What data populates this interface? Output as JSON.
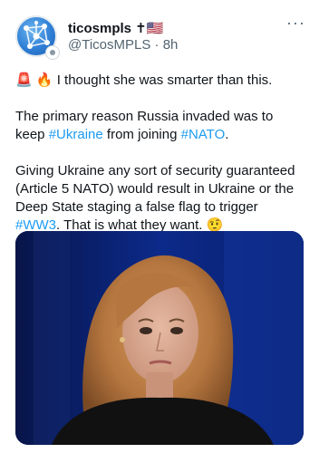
{
  "post": {
    "author": {
      "display_name": "ticosmpls ✝🇺🇸",
      "handle": "@TicosMPLS",
      "separator": "·",
      "timestamp": "8h"
    },
    "more_menu_label": "···",
    "text": {
      "line1_emoji": "🚨 🔥",
      "line1_text": " I thought she was smarter than this.",
      "p2_before": "The primary reason Russia invaded was to keep ",
      "p2_hashtag1": "#Ukraine",
      "p2_middle": " from joining ",
      "p2_hashtag2": "#NATO",
      "p2_after": ".",
      "p3_before": "Giving Ukraine any sort of security guaranteed (Article 5 NATO) would result in Ukraine or the Deep State staging a false flag to trigger ",
      "p3_hashtag": "#WW3",
      "p3_after": ". That is what they want. ",
      "p3_emoji": "🤨"
    },
    "media": {
      "icon": "photo-of-woman",
      "colors": {
        "background": "#0a1f6b",
        "hair": "#b5763f",
        "skin": "#d8a890",
        "clothing": "#111111"
      }
    },
    "colors": {
      "link": "#1d9bf0",
      "text": "#0f1419",
      "secondary": "#536471"
    }
  }
}
